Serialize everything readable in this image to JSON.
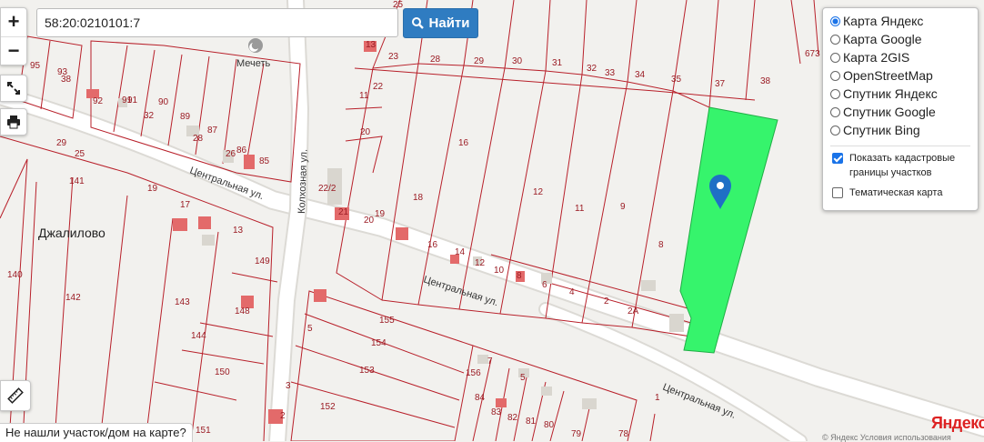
{
  "search": {
    "value": "58:20:0210101:7",
    "button_label": "Найти"
  },
  "zoom": {
    "plus": "+",
    "minus": "−"
  },
  "icons": {
    "search": "search-icon",
    "fullscreen": "fullscreen-icon",
    "print": "print-icon",
    "ruler": "ruler-icon",
    "pin": "map-pin-icon",
    "poi": "mosque-icon"
  },
  "layers": {
    "options": [
      "Карта Яндекс",
      "Карта Google",
      "Карта 2GIS",
      "OpenStreetMap",
      "Спутник Яндекс",
      "Спутник Google",
      "Спутник Bing"
    ],
    "selected": "Карта Яндекс",
    "show_cadastral": {
      "label": "Показать кадастровые границы участков",
      "checked": true
    },
    "thematic": {
      "label": "Тематическая карта",
      "checked": false
    }
  },
  "not_found_label": "Не нашли участок/дом на карте?",
  "provider_logo": "Яндекс",
  "copyright": "© Яндекс Условия использования",
  "map": {
    "village": "Джалилово",
    "poi_label": "Мечеть",
    "streets": [
      "Центральная ул.",
      "Центральная ул.",
      "Центральная ул.",
      "Колхозная ул."
    ],
    "parcel_labels": [
      "25",
      "95",
      "93",
      "38",
      "92",
      "91",
      "91",
      "32",
      "90",
      "89",
      "28",
      "87",
      "26",
      "86",
      "85",
      "29",
      "25",
      "141",
      "19",
      "17",
      "13",
      "140",
      "142",
      "143",
      "144",
      "148",
      "149",
      "150",
      "151",
      "3",
      "5",
      "2",
      "155",
      "154",
      "153",
      "152",
      "156",
      "7",
      "5",
      "84",
      "83",
      "82",
      "81",
      "80",
      "79",
      "78",
      "13",
      "23",
      "28",
      "29",
      "30",
      "31",
      "32",
      "33",
      "34",
      "35",
      "37",
      "38",
      "673",
      "11",
      "22",
      "20",
      "22/2",
      "21",
      "20",
      "19",
      "18",
      "16",
      "12",
      "11",
      "9",
      "8",
      "16",
      "14",
      "12",
      "10",
      "8",
      "6",
      "4",
      "2",
      "2А",
      "1"
    ],
    "colors": {
      "parcel_border": "#b8202a",
      "selected_parcel": "#36f46c",
      "pin": "#1f6fc5",
      "building": "#d9d6cf",
      "building_red": "#e36a6a"
    }
  }
}
